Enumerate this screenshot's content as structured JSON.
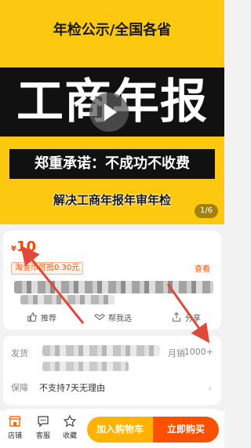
{
  "banner": {
    "topline": "年检公示/全国各省",
    "headline": "工商年报",
    "promise": "郑重承诺：不成功不收费",
    "subline": "解决工商年报年审年检",
    "pager": "1/6",
    "play_icon": "play-icon"
  },
  "product": {
    "currency": "¥",
    "price": "10",
    "coupon": "淘金币可抵0.30元",
    "view_more": "查看",
    "actions": [
      {
        "label": "推荐",
        "icon": "thumb-up-icon"
      },
      {
        "label": "帮我选",
        "icon": "handshake-icon"
      },
      {
        "label": "分享",
        "icon": "share-icon"
      }
    ]
  },
  "shipping": {
    "ship_label": "发货",
    "sales_label": "月销",
    "sales_value": "1000+",
    "guarantee_label": "保障",
    "guarantee_value": "不支持7天无理由"
  },
  "bottombar": {
    "store_label": "店铺",
    "service_label": "客服",
    "favorite_label": "收藏",
    "cart_label": "加入购物车",
    "buy_label": "立即购买"
  },
  "colors": {
    "banner": "#fcc810",
    "price": "#ff4400",
    "cart_button": "#ffb300",
    "buy_button": "#ff5000",
    "arrow": "#e0483a"
  }
}
